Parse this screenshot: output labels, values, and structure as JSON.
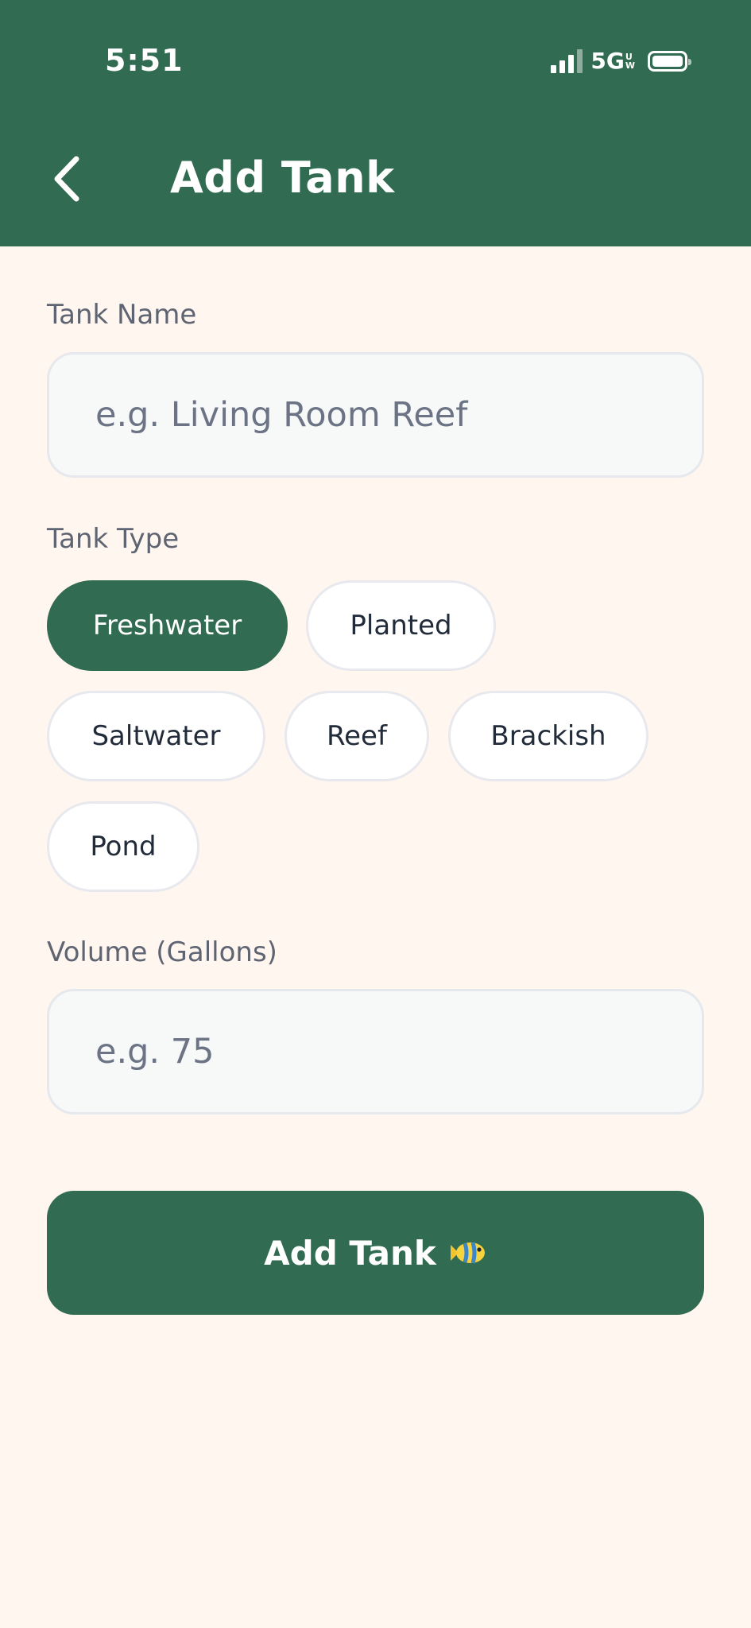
{
  "status_bar": {
    "time": "5:51",
    "network": "5G",
    "network_badge_top": "U",
    "network_badge_bottom": "W"
  },
  "header": {
    "title": "Add Tank",
    "back_icon": "chevron-left-icon"
  },
  "form": {
    "tank_name": {
      "label": "Tank Name",
      "placeholder": "e.g. Living Room Reef",
      "value": ""
    },
    "tank_type": {
      "label": "Tank Type",
      "options": [
        "Freshwater",
        "Planted",
        "Saltwater",
        "Reef",
        "Brackish",
        "Pond"
      ],
      "selected": "Freshwater"
    },
    "volume": {
      "label": "Volume (Gallons)",
      "placeholder": "e.g. 75",
      "value": ""
    },
    "submit": {
      "label": "Add Tank",
      "icon": "fish-icon"
    }
  },
  "colors": {
    "brand": "#316B51",
    "background": "#FFF6EF",
    "input_background": "#F7F8F8",
    "label_text": "#5E6472"
  }
}
